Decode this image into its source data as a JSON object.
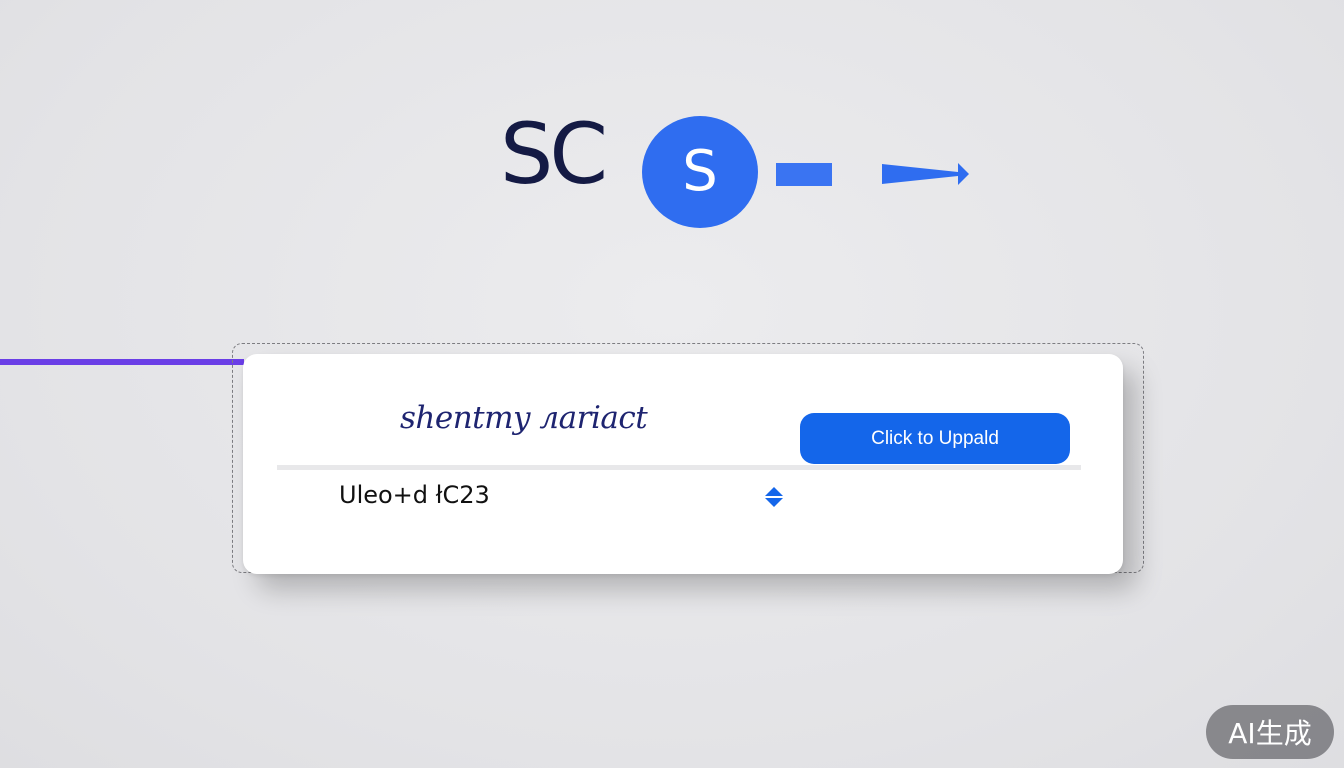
{
  "brand": {
    "logo_text": "SC",
    "logo_badge_letter": "S",
    "accent_color": "#2f6df0",
    "text_color": "#141a44",
    "connector_color": "#6a3ee6"
  },
  "upload_card": {
    "title": "shentmy лаriact",
    "upload_button_label": "Click to Uppald",
    "file_name": "Uleo+d łC23",
    "sort_icon": "sort-up-down-icon"
  },
  "watermark": {
    "label": "AI生成"
  }
}
